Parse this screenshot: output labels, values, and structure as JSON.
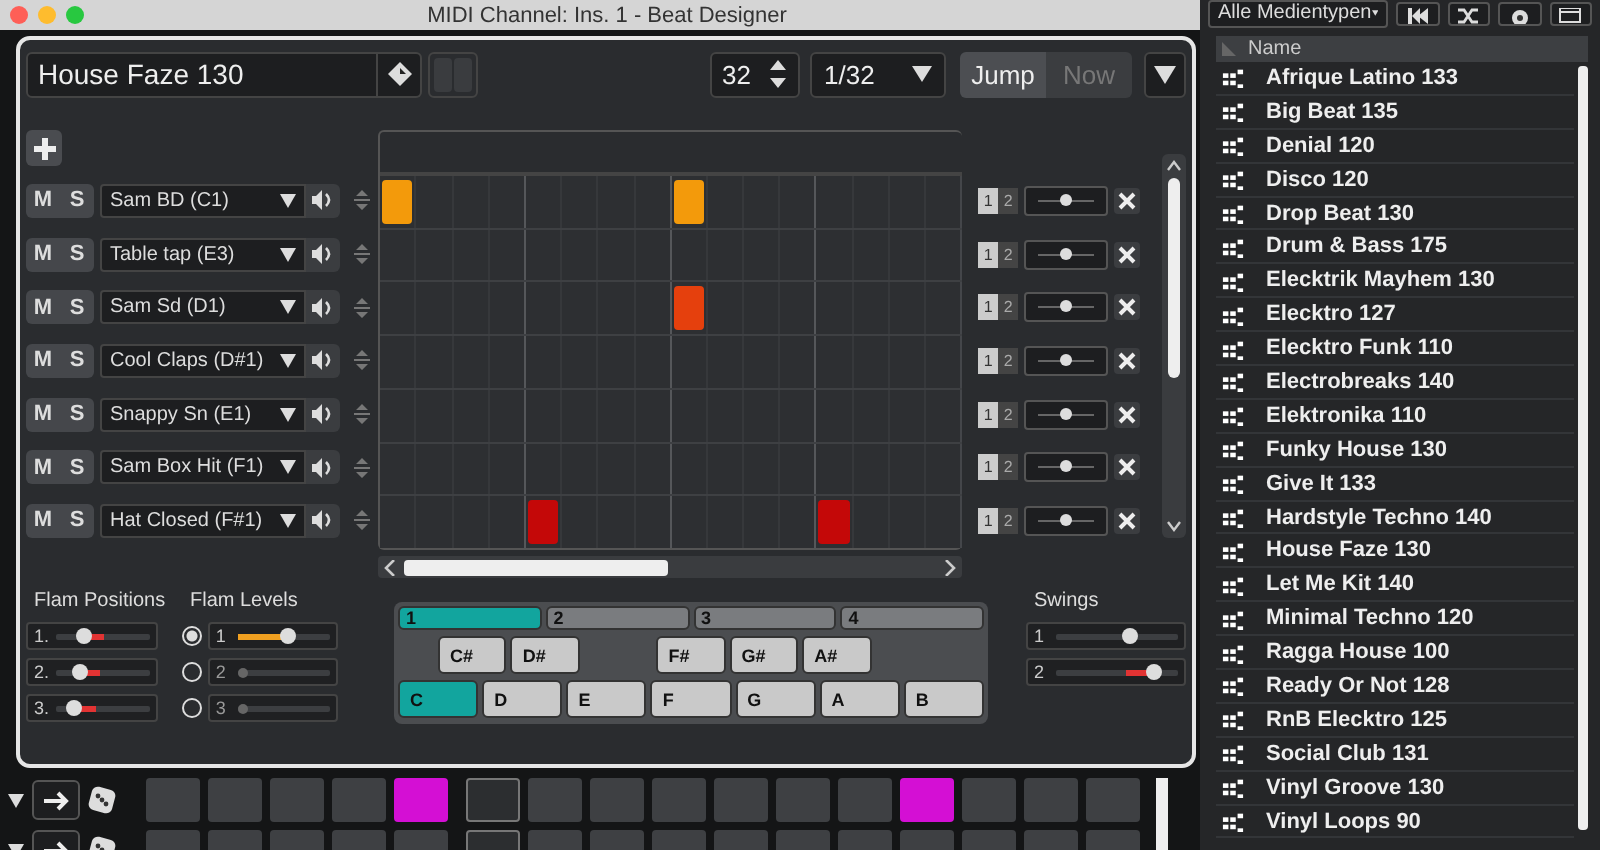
{
  "window": {
    "title": "MIDI Channel: Ins. 1 - Beat Designer"
  },
  "toolbar": {
    "pattern_name": "House Faze 130",
    "steps": "32",
    "resolution": "1/32",
    "jump_buttons": [
      {
        "label": "Jump",
        "selected": true
      },
      {
        "label": "Now",
        "selected": false
      }
    ]
  },
  "lanes": [
    {
      "mute": "M",
      "solo": "S",
      "instrument": "Sam BD (C1)",
      "color": "#f39a0b",
      "steps": [
        true,
        false,
        false,
        false,
        false,
        false,
        false,
        false,
        true,
        false,
        false,
        false,
        false,
        false,
        false,
        false
      ],
      "toggles": [
        {
          "label": "1",
          "selected": true
        },
        {
          "label": "2",
          "selected": false
        }
      ],
      "level": 0.5
    },
    {
      "mute": "M",
      "solo": "S",
      "instrument": "Table tap (E3)",
      "steps": [
        false,
        false,
        false,
        false,
        false,
        false,
        false,
        false,
        false,
        false,
        false,
        false,
        false,
        false,
        false,
        false
      ],
      "toggles": [
        {
          "label": "1",
          "selected": true
        },
        {
          "label": "2",
          "selected": false
        }
      ],
      "level": 0.5
    },
    {
      "mute": "M",
      "solo": "S",
      "instrument": "Sam Sd (D1)",
      "color": "#e5400d",
      "steps": [
        false,
        false,
        false,
        false,
        false,
        false,
        false,
        false,
        true,
        false,
        false,
        false,
        false,
        false,
        false,
        false
      ],
      "toggles": [
        {
          "label": "1",
          "selected": true
        },
        {
          "label": "2",
          "selected": false
        }
      ],
      "level": 0.5
    },
    {
      "mute": "M",
      "solo": "S",
      "instrument": "Cool Claps (D#1)",
      "steps": [
        false,
        false,
        false,
        false,
        false,
        false,
        false,
        false,
        false,
        false,
        false,
        false,
        false,
        false,
        false,
        false
      ],
      "toggles": [
        {
          "label": "1",
          "selected": true
        },
        {
          "label": "2",
          "selected": false
        }
      ],
      "level": 0.5
    },
    {
      "mute": "M",
      "solo": "S",
      "instrument": "Snappy Sn (E1)",
      "steps": [
        false,
        false,
        false,
        false,
        false,
        false,
        false,
        false,
        false,
        false,
        false,
        false,
        false,
        false,
        false,
        false
      ],
      "toggles": [
        {
          "label": "1",
          "selected": true
        },
        {
          "label": "2",
          "selected": false
        }
      ],
      "level": 0.5
    },
    {
      "mute": "M",
      "solo": "S",
      "instrument": "Sam Box Hit (F1)",
      "steps": [
        false,
        false,
        false,
        false,
        false,
        false,
        false,
        false,
        false,
        false,
        false,
        false,
        false,
        false,
        false,
        false
      ],
      "toggles": [
        {
          "label": "1",
          "selected": true
        },
        {
          "label": "2",
          "selected": false
        }
      ],
      "level": 0.5
    },
    {
      "mute": "M",
      "solo": "S",
      "instrument": "Hat Closed (F#1)",
      "color": "#c40808",
      "steps": [
        false,
        false,
        false,
        false,
        true,
        false,
        false,
        false,
        false,
        false,
        false,
        false,
        true,
        false,
        false,
        false
      ],
      "toggles": [
        {
          "label": "1",
          "selected": true
        },
        {
          "label": "2",
          "selected": false
        }
      ],
      "level": 0.5
    }
  ],
  "flam_positions": {
    "title": "Flam Positions",
    "sliders": [
      {
        "label": "1.",
        "level": 0.3
      },
      {
        "label": "2.",
        "level": 0.25
      },
      {
        "label": "3.",
        "level": 0.2
      }
    ]
  },
  "flam_levels": {
    "title": "Flam Levels",
    "sliders": [
      {
        "label": "1",
        "selected": true,
        "disabled": false,
        "level": 0.55
      },
      {
        "label": "2",
        "selected": false,
        "disabled": true,
        "level": 0
      },
      {
        "label": "3",
        "selected": false,
        "disabled": true,
        "level": 0
      }
    ]
  },
  "pattern_banks": [
    {
      "label": "1",
      "selected": true
    },
    {
      "label": "2",
      "selected": false
    },
    {
      "label": "3",
      "selected": false
    },
    {
      "label": "4",
      "selected": false
    }
  ],
  "black_keys": [
    {
      "label": "C#",
      "gap_before": false,
      "selected": false
    },
    {
      "label": "D#",
      "gap_before": false,
      "selected": false
    },
    {
      "label": "F#",
      "gap_before": true,
      "selected": false
    },
    {
      "label": "G#",
      "gap_before": false,
      "selected": false
    },
    {
      "label": "A#",
      "gap_before": false,
      "selected": false
    }
  ],
  "white_keys": [
    {
      "label": "C",
      "selected": true
    },
    {
      "label": "D",
      "selected": false
    },
    {
      "label": "E",
      "selected": false
    },
    {
      "label": "F",
      "selected": false
    },
    {
      "label": "G",
      "selected": false
    },
    {
      "label": "A",
      "selected": false
    },
    {
      "label": "B",
      "selected": false
    }
  ],
  "swings": {
    "title": "Swings",
    "sliders": [
      {
        "label": "1",
        "level": 0.6
      },
      {
        "label": "2",
        "level": 0.8
      }
    ]
  },
  "pad_rows": [
    [
      {
        "on": false,
        "selected": false
      },
      {
        "on": false,
        "selected": false
      },
      {
        "on": false,
        "selected": false
      },
      {
        "on": false,
        "selected": false
      },
      {
        "on": true,
        "selected": false
      },
      {
        "on": false,
        "selected": true
      },
      {
        "on": false,
        "selected": false
      },
      {
        "on": false,
        "selected": false
      },
      {
        "on": false,
        "selected": false
      },
      {
        "on": false,
        "selected": false
      },
      {
        "on": false,
        "selected": false
      },
      {
        "on": false,
        "selected": false
      },
      {
        "on": true,
        "selected": false
      },
      {
        "on": false,
        "selected": false
      },
      {
        "on": false,
        "selected": false
      },
      {
        "on": false,
        "selected": false
      }
    ],
    [
      {
        "on": false,
        "selected": false
      },
      {
        "on": false,
        "selected": false
      },
      {
        "on": false,
        "selected": false
      },
      {
        "on": false,
        "selected": false
      },
      {
        "on": false,
        "selected": false
      },
      {
        "on": false,
        "selected": true
      },
      {
        "on": false,
        "selected": false
      },
      {
        "on": false,
        "selected": false
      },
      {
        "on": false,
        "selected": false
      },
      {
        "on": false,
        "selected": false
      },
      {
        "on": false,
        "selected": false
      },
      {
        "on": false,
        "selected": false
      },
      {
        "on": false,
        "selected": false
      },
      {
        "on": false,
        "selected": false
      },
      {
        "on": false,
        "selected": false
      },
      {
        "on": false,
        "selected": false
      }
    ]
  ],
  "browser": {
    "filter": "Alle Medientypen",
    "column": "Name",
    "items": [
      "Afrique Latino 133",
      "Big Beat 135",
      "Denial 120",
      "Disco 120",
      "Drop Beat 130",
      "Drum & Bass 175",
      "Elecktrik Mayhem 130",
      "Elecktro 127",
      "Elecktro Funk 110",
      "Electrobreaks 140",
      "Elektronika 110",
      "Funky House 130",
      "Give It 133",
      "Hardstyle Techno 140",
      "House Faze 130",
      "Let Me Kit 140",
      "Minimal Techno 120",
      "Ragga House 100",
      "Ready Or Not 128",
      "RnB Elecktro 125",
      "Social Club 131",
      "Vinyl Groove 130",
      "Vinyl Loops 90"
    ]
  }
}
